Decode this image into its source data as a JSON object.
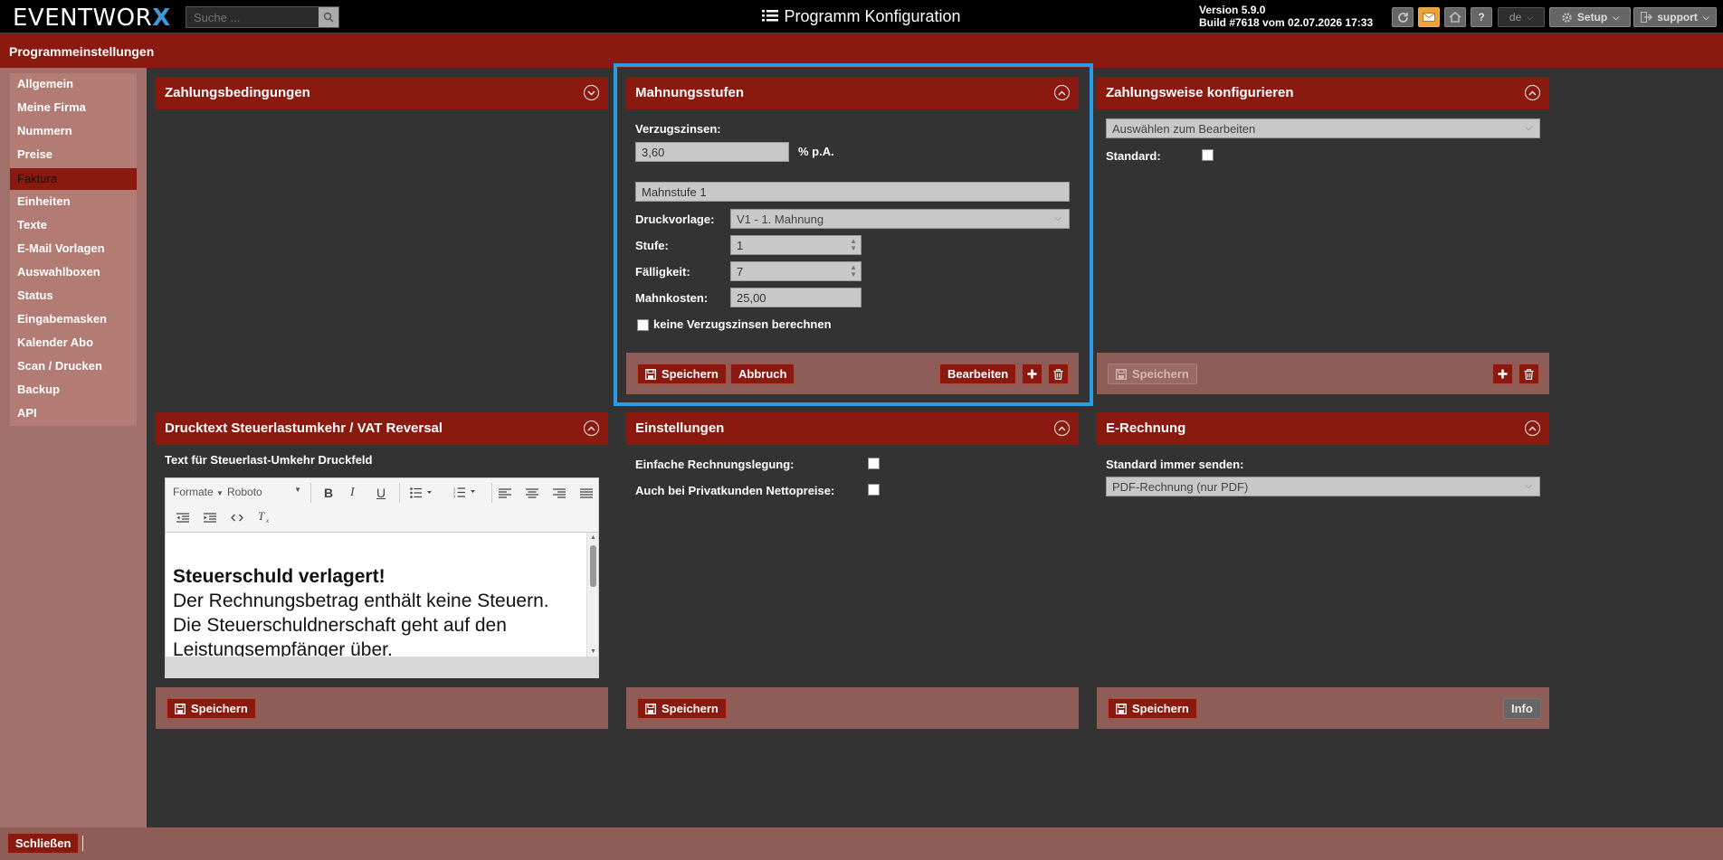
{
  "topbar": {
    "logo_text": "EVENTWOR",
    "logo_x": "X",
    "search_placeholder": "Suche ...",
    "title": "Programm Konfiguration",
    "version_line1": "Version 5.9.0",
    "version_line2": "Build #7618 vom 02.07.2026 17:33",
    "lang": "de",
    "setup_label": "Setup",
    "user_label": "support",
    "help_label": "?"
  },
  "header": {
    "title": "Programmeinstellungen"
  },
  "sidebar": {
    "items": [
      {
        "label": "Allgemein"
      },
      {
        "label": "Meine Firma"
      },
      {
        "label": "Nummern"
      },
      {
        "label": "Preise"
      },
      {
        "label": "Faktura"
      },
      {
        "label": "Einheiten"
      },
      {
        "label": "Texte"
      },
      {
        "label": "E-Mail Vorlagen"
      },
      {
        "label": "Auswahlboxen"
      },
      {
        "label": "Status"
      },
      {
        "label": "Eingabemasken"
      },
      {
        "label": "Kalender Abo"
      },
      {
        "label": "Scan / Drucken"
      },
      {
        "label": "Backup"
      },
      {
        "label": "API"
      }
    ],
    "active": "Faktura"
  },
  "zahlungsbedingungen": {
    "title": "Zahlungsbedingungen"
  },
  "mahnungsstufen": {
    "title": "Mahnungsstufen",
    "verzugszinsen_label": "Verzugszinsen:",
    "verzugszinsen_value": "3,60",
    "verzugszinsen_unit": "% p.A.",
    "stufe_name": "Mahnstufe 1",
    "druckvorlage_label": "Druckvorlage:",
    "druckvorlage_value": "V1 - 1. Mahnung",
    "stufe_label": "Stufe:",
    "stufe_value": "1",
    "faelligkeit_label": "Fälligkeit:",
    "faelligkeit_value": "7",
    "mahnkosten_label": "Mahnkosten:",
    "mahnkosten_value": "25,00",
    "keine_zinsen_label": "keine Verzugszinsen berechnen",
    "save_label": "Speichern",
    "cancel_label": "Abbruch",
    "edit_label": "Bearbeiten"
  },
  "zahlungsweise": {
    "title": "Zahlungsweise konfigurieren",
    "select_value": "Auswählen zum Bearbeiten",
    "standard_label": "Standard:",
    "save_label": "Speichern"
  },
  "drucktext": {
    "title": "Drucktext Steuerlastumkehr / VAT Reversal",
    "subtitle": "Text für Steuerlast-Umkehr Druckfeld",
    "formats_label": "Formate",
    "font_label": "Roboto",
    "text_heading": "Steuerschuld verlagert!",
    "text_line1": "Der Rechnungsbetrag enthält keine Steuern.",
    "text_line2": "Die Steuerschuldnerschaft geht auf den",
    "text_line3": "Leistungsempfänger über.",
    "save_label": "Speichern"
  },
  "einstellungen": {
    "title": "Einstellungen",
    "einfache_label": "Einfache Rechnungslegung:",
    "privat_label": "Auch bei Privatkunden Nettopreise:",
    "save_label": "Speichern"
  },
  "erechnung": {
    "title": "E-Rechnung",
    "standard_label": "Standard immer senden:",
    "select_value": "PDF-Rechnung (nur PDF)",
    "save_label": "Speichern",
    "info_label": "Info"
  },
  "bottom": {
    "close_label": "Schließen"
  },
  "colors": {
    "brand_red": "#8a1a10",
    "highlight_blue": "#2b9be3",
    "accent_blue": "#3a9ad9"
  }
}
